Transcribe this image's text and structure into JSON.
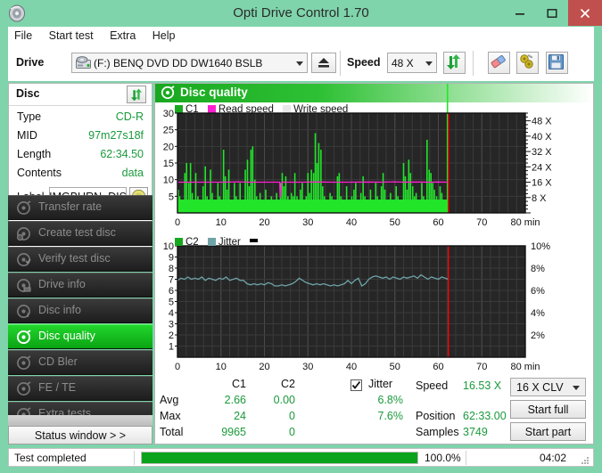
{
  "window": {
    "title": "Opti Drive Control 1.70",
    "app_icon": "disc-icon",
    "minimize": "minimize-icon",
    "maximize": "maximize-icon",
    "close": "close-icon"
  },
  "menu": {
    "items": [
      "File",
      "Start test",
      "Extra",
      "Help"
    ]
  },
  "toolbar": {
    "drive_label": "Drive",
    "drive_value": "(F:)   BENQ DVD DD DW1640 BSLB",
    "eject_icon": "eject-icon",
    "speed_label": "Speed",
    "speed_value": "48 X",
    "refresh_icon": "refresh-icon",
    "eraser_icon": "eraser-icon",
    "tools_icon": "tools-icon",
    "save_icon": "floppy-save-icon"
  },
  "disc_panel": {
    "header": "Disc",
    "refresh_icon": "refresh-icon",
    "rows": [
      {
        "key": "Type",
        "value": "CD-R"
      },
      {
        "key": "MID",
        "value": "97m27s18f"
      },
      {
        "key": "Length",
        "value": "62:34.50"
      },
      {
        "key": "Contents",
        "value": "data"
      }
    ],
    "label_key": "Label",
    "label_value": "IMGBURN_DIS",
    "label_button_icon": "cd-disc-icon"
  },
  "sidebar": {
    "items": [
      {
        "label": "Transfer rate",
        "icon": "disc-transfer-icon",
        "active": false
      },
      {
        "label": "Create test disc",
        "icon": "disc-create-icon",
        "active": false
      },
      {
        "label": "Verify test disc",
        "icon": "disc-verify-icon",
        "active": false
      },
      {
        "label": "Drive info",
        "icon": "drive-info-icon",
        "active": false
      },
      {
        "label": "Disc info",
        "icon": "disc-info-icon",
        "active": false
      },
      {
        "label": "Disc quality",
        "icon": "disc-quality-icon",
        "active": true
      },
      {
        "label": "CD Bler",
        "icon": "disc-bler-icon",
        "active": false
      },
      {
        "label": "FE / TE",
        "icon": "disc-fete-icon",
        "active": false
      },
      {
        "label": "Extra tests",
        "icon": "disc-extra-icon",
        "active": false
      }
    ],
    "status_window_button": "Status window > >"
  },
  "main": {
    "header_title": "Disc quality",
    "header_icon": "disc-quality-icon"
  },
  "stats": {
    "col_headers": [
      "C1",
      "C2"
    ],
    "rows": [
      {
        "label": "Avg",
        "c1": "2.66",
        "c2": "0.00",
        "jitter": "6.8%"
      },
      {
        "label": "Max",
        "c1": "24",
        "c2": "0",
        "jitter": "7.6%"
      },
      {
        "label": "Total",
        "c1": "9965",
        "c2": "0",
        "jitter": ""
      }
    ],
    "jitter_label": "Jitter",
    "jitter_checked": true,
    "speed_label": "Speed",
    "speed_value": "16.53 X",
    "position_label": "Position",
    "position_value": "62:33.00",
    "samples_label": "Samples",
    "samples_value": "3749",
    "speed_select": "16 X CLV",
    "start_full": "Start full",
    "start_part": "Start part"
  },
  "statusbar": {
    "message": "Test completed",
    "progress_percent": 100.0,
    "progress_text": "100.0%",
    "elapsed": "04:02"
  },
  "colors": {
    "accent_green": "#18a81f",
    "c1_green": "#22e52a",
    "read_speed_magenta": "#ff1fd0",
    "write_speed_gray": "#e8e8e8",
    "jitter_teal": "#6fa3a8",
    "marker_red": "#ff0000",
    "value_green": "#1a9a3c",
    "window_bg": "#7fd4ab",
    "close_red": "#c0504d"
  },
  "chart_data": [
    {
      "type": "line",
      "name": "c1-chart",
      "title": "",
      "xlabel": "min",
      "ylabel": "",
      "xlim": [
        0,
        80
      ],
      "ylim": [
        0,
        30
      ],
      "x_ticks": [
        0,
        10,
        20,
        30,
        40,
        50,
        60,
        70,
        80
      ],
      "x_tick_labels": [
        "0",
        "10",
        "20",
        "30",
        "40",
        "50",
        "60",
        "70",
        "80 min"
      ],
      "y_ticks": [
        5,
        10,
        15,
        20,
        25,
        30
      ],
      "y_tick_labels": [
        "5",
        "10",
        "15",
        "20",
        "25",
        "30"
      ],
      "y2_ticks": [
        8,
        16,
        24,
        32,
        40,
        48
      ],
      "y2_tick_labels": [
        "8 X",
        "16 X",
        "24 X",
        "32 X",
        "40 X",
        "48 X"
      ],
      "y2_lim": [
        0,
        52
      ],
      "grid": true,
      "legend_position": "top-left",
      "legend": [
        {
          "name": "C1",
          "color": "#18a81f"
        },
        {
          "name": "Read speed",
          "color": "#ff1fd0"
        },
        {
          "name": "Write speed",
          "color": "#e8e8e8"
        }
      ],
      "marker_x": 62.3,
      "data_end_x": 62.3,
      "series": [
        {
          "name": "C1",
          "color": "#22e52a",
          "type": "spike",
          "x": [
            0.2,
            0.5,
            0.9,
            1.3,
            1.7,
            2.1,
            2.6,
            3.0,
            3.4,
            3.8,
            4.2,
            4.7,
            5.1,
            5.5,
            5.9,
            6.4,
            6.8,
            7.2,
            7.6,
            8.0,
            8.5,
            8.9,
            9.3,
            9.7,
            10.2,
            10.6,
            11.0,
            11.4,
            11.8,
            12.3,
            12.7,
            13.1,
            13.5,
            14.0,
            14.4,
            14.8,
            15.2,
            15.6,
            16.1,
            16.5,
            16.9,
            17.3,
            17.8,
            18.2,
            18.6,
            19.0,
            19.4,
            19.9,
            20.3,
            20.7,
            21.1,
            21.6,
            22.0,
            22.4,
            22.8,
            23.2,
            23.7,
            24.1,
            24.5,
            24.9,
            25.4,
            25.8,
            26.2,
            26.6,
            27.0,
            27.5,
            27.9,
            28.3,
            28.7,
            29.2,
            29.6,
            30.0,
            30.4,
            30.8,
            31.3,
            31.7,
            32.1,
            32.5,
            33.0,
            33.4,
            33.8,
            34.2,
            34.6,
            35.1,
            35.5,
            35.9,
            36.3,
            36.8,
            37.2,
            37.6,
            38.0,
            38.4,
            38.9,
            39.3,
            39.7,
            40.1,
            40.6,
            41.0,
            41.4,
            41.8,
            42.2,
            42.7,
            43.1,
            43.5,
            43.9,
            44.4,
            44.8,
            45.2,
            45.6,
            46.0,
            46.5,
            46.9,
            47.3,
            47.7,
            48.2,
            48.6,
            49.0,
            49.4,
            49.8,
            50.3,
            50.7,
            51.1,
            51.5,
            52.0,
            52.4,
            52.8,
            53.2,
            53.6,
            54.1,
            54.5,
            54.9,
            55.3,
            55.8,
            56.2,
            56.6,
            57.0,
            57.4,
            57.9,
            58.3,
            58.7,
            59.1,
            59.6,
            60.0,
            60.4,
            60.8,
            61.2,
            61.7,
            62.1
          ],
          "y": [
            7,
            5,
            4,
            3,
            12,
            15,
            9,
            15,
            6,
            4,
            12,
            5,
            4,
            3,
            8,
            14,
            5,
            4,
            13,
            6,
            3,
            4,
            9,
            5,
            4,
            19,
            11,
            7,
            13,
            4,
            3,
            9,
            5,
            4,
            9,
            3,
            4,
            13,
            16,
            8,
            19,
            20,
            10,
            5,
            4,
            6,
            3,
            4,
            7,
            3,
            4,
            5,
            3,
            4,
            6,
            4,
            9,
            12,
            8,
            11,
            5,
            4,
            6,
            5,
            12,
            5,
            4,
            7,
            9,
            4,
            5,
            12,
            6,
            13,
            12,
            24,
            15,
            21,
            19,
            8,
            5,
            4,
            3,
            6,
            5,
            4,
            3,
            11,
            12,
            5,
            4,
            3,
            8,
            4,
            3,
            5,
            7,
            9,
            4,
            3,
            6,
            11,
            5,
            4,
            3,
            7,
            4,
            3,
            9,
            5,
            4,
            8,
            12,
            7,
            3,
            4,
            6,
            4,
            3,
            8,
            5,
            4,
            3,
            15,
            11,
            7,
            16,
            12,
            8,
            5,
            6,
            4,
            3,
            9,
            5,
            4,
            22,
            13,
            12,
            9,
            7,
            5,
            4,
            8,
            6,
            4,
            3
          ]
        },
        {
          "name": "Read speed",
          "color": "#ff1fd0",
          "type": "line",
          "x": [
            0,
            2,
            5,
            10,
            14,
            16,
            20,
            23.5,
            23.6,
            24,
            28,
            32,
            36,
            40,
            44,
            47,
            50,
            52,
            55,
            58,
            60,
            62.2
          ],
          "y_x_units": [
            16,
            16,
            16,
            16,
            16.2,
            16,
            16,
            16,
            8,
            16,
            16,
            16.1,
            16,
            16,
            16.1,
            16,
            16.2,
            16,
            16.1,
            16,
            16.1,
            16
          ]
        }
      ]
    },
    {
      "type": "line",
      "name": "c2-jitter-chart",
      "title": "",
      "xlabel": "min",
      "ylabel": "",
      "xlim": [
        0,
        80
      ],
      "ylim": [
        0,
        10
      ],
      "x_ticks": [
        0,
        10,
        20,
        30,
        40,
        50,
        60,
        70,
        80
      ],
      "x_tick_labels": [
        "0",
        "10",
        "20",
        "30",
        "40",
        "50",
        "60",
        "70",
        "80 min"
      ],
      "y_ticks": [
        1,
        2,
        3,
        4,
        5,
        6,
        7,
        8,
        9,
        10
      ],
      "y_tick_labels": [
        "1",
        "2",
        "3",
        "4",
        "5",
        "6",
        "7",
        "8",
        "9",
        "10"
      ],
      "y2_ticks": [
        2,
        4,
        6,
        8,
        10
      ],
      "y2_tick_labels": [
        "2%",
        "4%",
        "6%",
        "8%",
        "10%"
      ],
      "grid": true,
      "legend_position": "top-left",
      "legend": [
        {
          "name": "C2",
          "color": "#18a81f"
        },
        {
          "name": "Jitter",
          "color": "#6fa3a8"
        }
      ],
      "marker_x": 62.3,
      "data_end_x": 62.3,
      "series": [
        {
          "name": "C2",
          "color": "#18a81f",
          "type": "spike",
          "x": [],
          "y": []
        },
        {
          "name": "Jitter",
          "color": "#6fa3a8",
          "type": "line",
          "x": [
            0,
            0.8,
            1.6,
            2.4,
            3.2,
            4.0,
            4.8,
            5.6,
            6.4,
            7.2,
            8.0,
            8.8,
            9.6,
            10.4,
            11.2,
            12.0,
            12.8,
            13.6,
            14.4,
            15.2,
            16.0,
            16.8,
            17.6,
            18.4,
            19.2,
            20.0,
            20.8,
            21.6,
            22.4,
            23.2,
            24.0,
            24.8,
            25.6,
            26.4,
            27.2,
            28.0,
            28.8,
            29.6,
            30.4,
            31.2,
            32.0,
            32.8,
            33.6,
            34.4,
            35.2,
            36.0,
            36.8,
            37.6,
            38.4,
            39.2,
            40.0,
            40.8,
            41.6,
            42.4,
            43.2,
            44.0,
            44.8,
            45.6,
            46.4,
            47.2,
            48.0,
            48.8,
            49.6,
            50.4,
            51.2,
            52.0,
            52.8,
            53.6,
            54.4,
            55.2,
            56.0,
            56.8,
            57.6,
            58.4,
            59.2,
            60.0,
            60.8,
            61.6,
            62.2
          ],
          "y": [
            6.9,
            7.1,
            7.0,
            7.2,
            7.0,
            7.1,
            7.0,
            7.2,
            6.9,
            7.1,
            7.0,
            6.9,
            7.1,
            7.0,
            7.2,
            6.9,
            7.0,
            7.1,
            6.9,
            6.9,
            6.6,
            6.5,
            6.6,
            6.5,
            6.6,
            6.5,
            6.7,
            6.6,
            6.4,
            6.4,
            6.5,
            6.4,
            6.5,
            6.6,
            6.8,
            7.1,
            6.9,
            6.7,
            6.6,
            6.5,
            6.6,
            6.5,
            6.6,
            6.5,
            6.4,
            6.5,
            6.4,
            6.5,
            6.6,
            6.9,
            6.6,
            6.9,
            7.1,
            6.4,
            6.6,
            7.0,
            7.2,
            7.3,
            7.2,
            7.1,
            7.2,
            7.0,
            7.2,
            7.1,
            7.0,
            7.2,
            7.1,
            7.2,
            7.3,
            7.1,
            7.4,
            7.2,
            7.0,
            7.2,
            7.1,
            7.0,
            7.2,
            7.1,
            7.0
          ]
        }
      ]
    }
  ]
}
